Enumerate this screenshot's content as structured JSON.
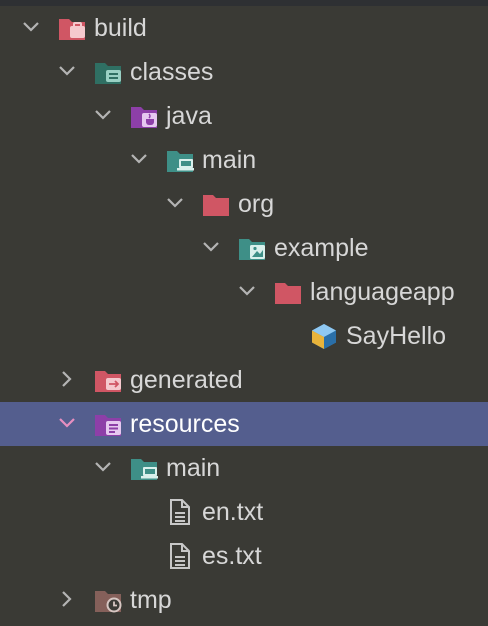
{
  "tree": {
    "rows": [
      {
        "label": "build",
        "expanded": true,
        "icon": "build-folder-icon"
      },
      {
        "label": "classes",
        "expanded": true,
        "icon": "classes-folder-icon"
      },
      {
        "label": "java",
        "expanded": true,
        "icon": "java-folder-icon"
      },
      {
        "label": "main",
        "expanded": true,
        "icon": "module-folder-icon"
      },
      {
        "label": "org",
        "expanded": true,
        "icon": "package-folder-icon"
      },
      {
        "label": "example",
        "expanded": true,
        "icon": "image-folder-icon"
      },
      {
        "label": "languageapp",
        "expanded": true,
        "icon": "package-folder-icon"
      },
      {
        "label": "SayHello",
        "icon": "class-file-icon"
      },
      {
        "label": "generated",
        "expanded": false,
        "icon": "generated-folder-icon"
      },
      {
        "label": "resources",
        "expanded": true,
        "selected": true,
        "icon": "resources-folder-icon"
      },
      {
        "label": "main",
        "expanded": true,
        "icon": "module-folder-icon"
      },
      {
        "label": "en.txt",
        "icon": "text-file-icon"
      },
      {
        "label": "es.txt",
        "icon": "text-file-icon"
      },
      {
        "label": "tmp",
        "expanded": false,
        "icon": "tmp-folder-icon"
      }
    ]
  },
  "colors": {
    "background": "#3a3a35",
    "selection": "#545e8e",
    "text": "#d7d7d7",
    "folder_red": "#d05664",
    "folder_teal": "#3e8f87",
    "folder_purple": "#8d3fa8",
    "folder_brown": "#85605a"
  }
}
